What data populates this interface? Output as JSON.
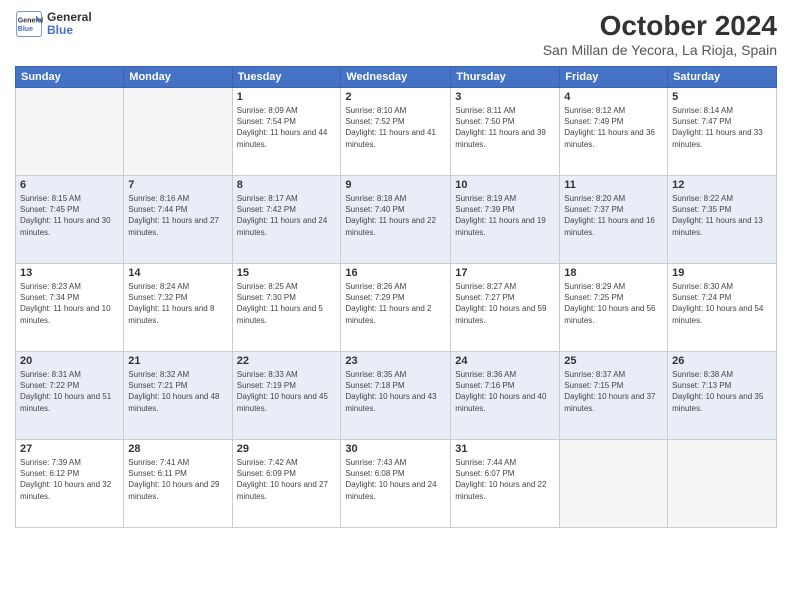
{
  "header": {
    "logo_line1": "General",
    "logo_line2": "Blue",
    "month_title": "October 2024",
    "location": "San Millan de Yecora, La Rioja, Spain"
  },
  "weekdays": [
    "Sunday",
    "Monday",
    "Tuesday",
    "Wednesday",
    "Thursday",
    "Friday",
    "Saturday"
  ],
  "weeks": [
    [
      {
        "day": "",
        "info": ""
      },
      {
        "day": "",
        "info": ""
      },
      {
        "day": "1",
        "info": "Sunrise: 8:09 AM\nSunset: 7:54 PM\nDaylight: 11 hours and 44 minutes."
      },
      {
        "day": "2",
        "info": "Sunrise: 8:10 AM\nSunset: 7:52 PM\nDaylight: 11 hours and 41 minutes."
      },
      {
        "day": "3",
        "info": "Sunrise: 8:11 AM\nSunset: 7:50 PM\nDaylight: 11 hours and 39 minutes."
      },
      {
        "day": "4",
        "info": "Sunrise: 8:12 AM\nSunset: 7:49 PM\nDaylight: 11 hours and 36 minutes."
      },
      {
        "day": "5",
        "info": "Sunrise: 8:14 AM\nSunset: 7:47 PM\nDaylight: 11 hours and 33 minutes."
      }
    ],
    [
      {
        "day": "6",
        "info": "Sunrise: 8:15 AM\nSunset: 7:45 PM\nDaylight: 11 hours and 30 minutes."
      },
      {
        "day": "7",
        "info": "Sunrise: 8:16 AM\nSunset: 7:44 PM\nDaylight: 11 hours and 27 minutes."
      },
      {
        "day": "8",
        "info": "Sunrise: 8:17 AM\nSunset: 7:42 PM\nDaylight: 11 hours and 24 minutes."
      },
      {
        "day": "9",
        "info": "Sunrise: 8:18 AM\nSunset: 7:40 PM\nDaylight: 11 hours and 22 minutes."
      },
      {
        "day": "10",
        "info": "Sunrise: 8:19 AM\nSunset: 7:39 PM\nDaylight: 11 hours and 19 minutes."
      },
      {
        "day": "11",
        "info": "Sunrise: 8:20 AM\nSunset: 7:37 PM\nDaylight: 11 hours and 16 minutes."
      },
      {
        "day": "12",
        "info": "Sunrise: 8:22 AM\nSunset: 7:35 PM\nDaylight: 11 hours and 13 minutes."
      }
    ],
    [
      {
        "day": "13",
        "info": "Sunrise: 8:23 AM\nSunset: 7:34 PM\nDaylight: 11 hours and 10 minutes."
      },
      {
        "day": "14",
        "info": "Sunrise: 8:24 AM\nSunset: 7:32 PM\nDaylight: 11 hours and 8 minutes."
      },
      {
        "day": "15",
        "info": "Sunrise: 8:25 AM\nSunset: 7:30 PM\nDaylight: 11 hours and 5 minutes."
      },
      {
        "day": "16",
        "info": "Sunrise: 8:26 AM\nSunset: 7:29 PM\nDaylight: 11 hours and 2 minutes."
      },
      {
        "day": "17",
        "info": "Sunrise: 8:27 AM\nSunset: 7:27 PM\nDaylight: 10 hours and 59 minutes."
      },
      {
        "day": "18",
        "info": "Sunrise: 8:29 AM\nSunset: 7:25 PM\nDaylight: 10 hours and 56 minutes."
      },
      {
        "day": "19",
        "info": "Sunrise: 8:30 AM\nSunset: 7:24 PM\nDaylight: 10 hours and 54 minutes."
      }
    ],
    [
      {
        "day": "20",
        "info": "Sunrise: 8:31 AM\nSunset: 7:22 PM\nDaylight: 10 hours and 51 minutes."
      },
      {
        "day": "21",
        "info": "Sunrise: 8:32 AM\nSunset: 7:21 PM\nDaylight: 10 hours and 48 minutes."
      },
      {
        "day": "22",
        "info": "Sunrise: 8:33 AM\nSunset: 7:19 PM\nDaylight: 10 hours and 45 minutes."
      },
      {
        "day": "23",
        "info": "Sunrise: 8:35 AM\nSunset: 7:18 PM\nDaylight: 10 hours and 43 minutes."
      },
      {
        "day": "24",
        "info": "Sunrise: 8:36 AM\nSunset: 7:16 PM\nDaylight: 10 hours and 40 minutes."
      },
      {
        "day": "25",
        "info": "Sunrise: 8:37 AM\nSunset: 7:15 PM\nDaylight: 10 hours and 37 minutes."
      },
      {
        "day": "26",
        "info": "Sunrise: 8:38 AM\nSunset: 7:13 PM\nDaylight: 10 hours and 35 minutes."
      }
    ],
    [
      {
        "day": "27",
        "info": "Sunrise: 7:39 AM\nSunset: 6:12 PM\nDaylight: 10 hours and 32 minutes."
      },
      {
        "day": "28",
        "info": "Sunrise: 7:41 AM\nSunset: 6:11 PM\nDaylight: 10 hours and 29 minutes."
      },
      {
        "day": "29",
        "info": "Sunrise: 7:42 AM\nSunset: 6:09 PM\nDaylight: 10 hours and 27 minutes."
      },
      {
        "day": "30",
        "info": "Sunrise: 7:43 AM\nSunset: 6:08 PM\nDaylight: 10 hours and 24 minutes."
      },
      {
        "day": "31",
        "info": "Sunrise: 7:44 AM\nSunset: 6:07 PM\nDaylight: 10 hours and 22 minutes."
      },
      {
        "day": "",
        "info": ""
      },
      {
        "day": "",
        "info": ""
      }
    ]
  ]
}
